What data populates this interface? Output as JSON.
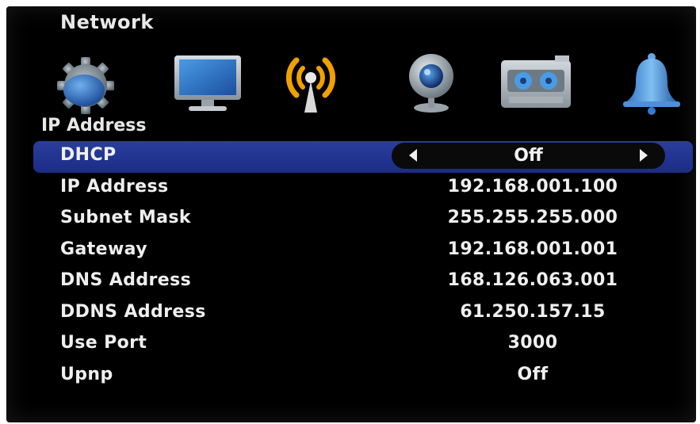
{
  "window": {
    "title": "Network"
  },
  "toolbar": {
    "icons": [
      "gear-icon",
      "monitor-icon",
      "wireless-icon",
      "webcam-icon",
      "tape-recorder-icon",
      "bell-icon"
    ],
    "active_icon": "wireless-icon"
  },
  "section": {
    "label": "IP Address"
  },
  "rows": [
    {
      "label": "DHCP",
      "value": "Off"
    },
    {
      "label": "IP Address",
      "value": "192.168.001.100"
    },
    {
      "label": "Subnet Mask",
      "value": "255.255.255.000"
    },
    {
      "label": "Gateway",
      "value": "192.168.001.001"
    },
    {
      "label": "DNS Address",
      "value": "168.126.063.001"
    },
    {
      "label": "DDNS Address",
      "value": "61.250.157.15"
    },
    {
      "label": "Use Port",
      "value": "3000"
    },
    {
      "label": "Upnp",
      "value": "Off"
    }
  ],
  "colors": {
    "selection": "#1f3390",
    "background": "#000000",
    "text": "#efefef",
    "accent_orange": "#f0a000"
  }
}
